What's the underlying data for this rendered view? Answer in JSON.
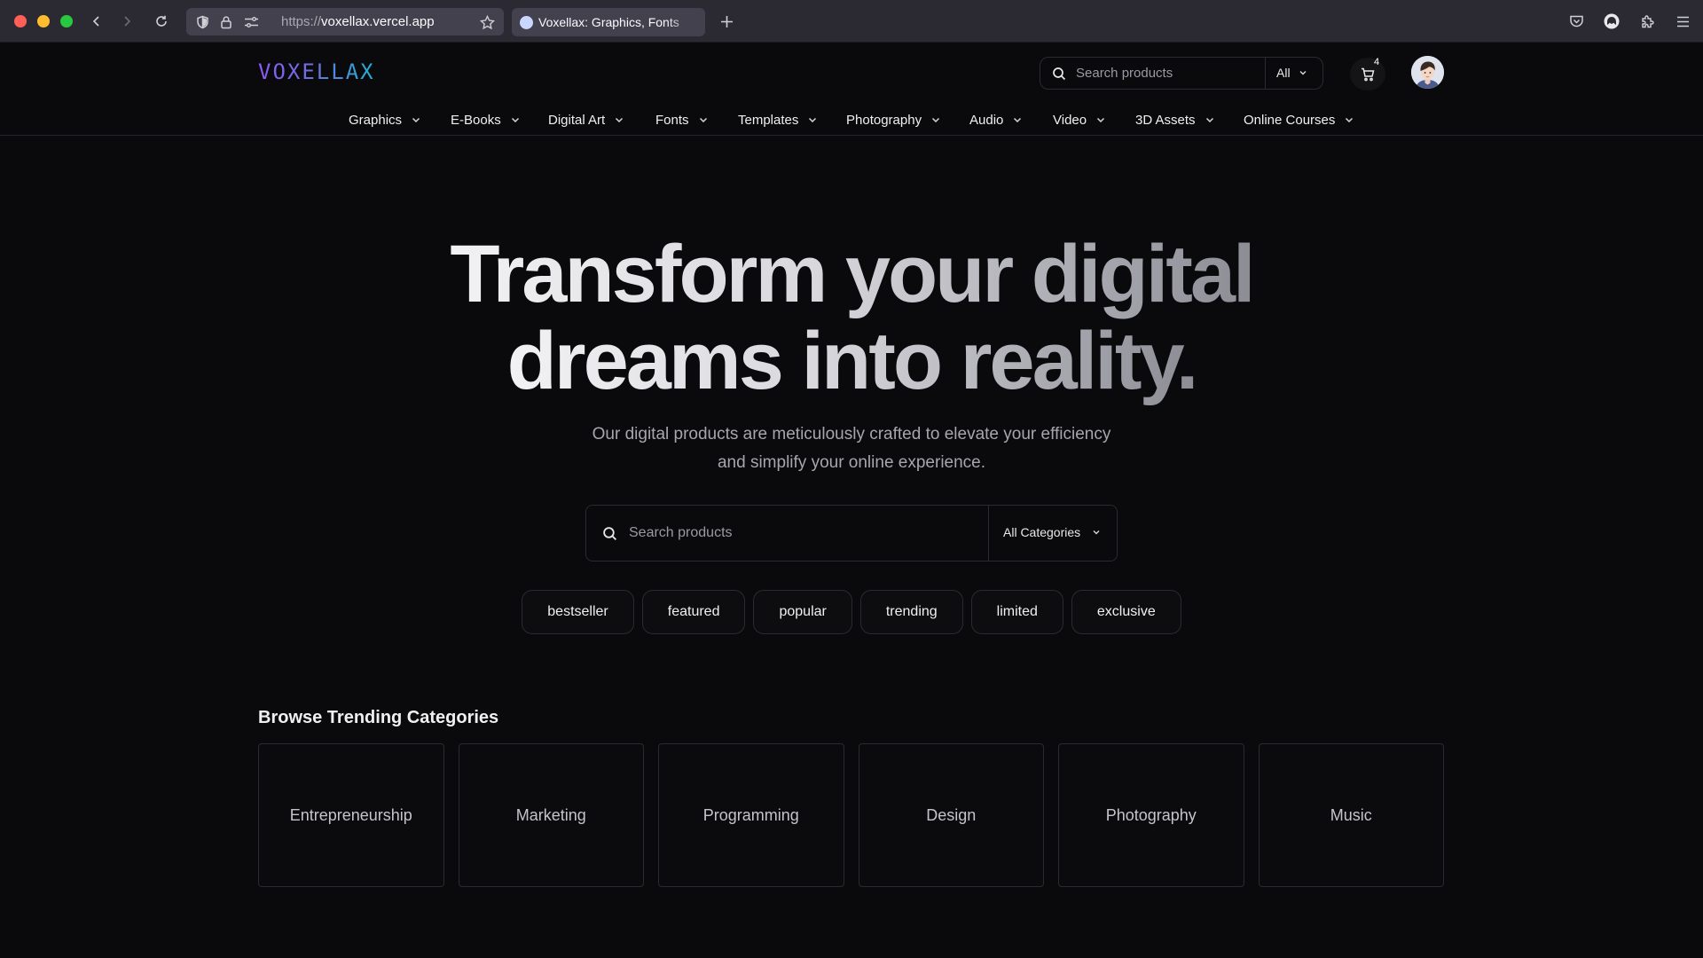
{
  "browser": {
    "url_scheme": "https://",
    "url_host": "voxellax.vercel.app",
    "tab_title": "Voxellax: Graphics, Fonts",
    "icons": [
      "back-icon",
      "forward-icon",
      "reload-icon",
      "shield-icon",
      "lock-icon",
      "permissions-icon",
      "bookmark-star-icon",
      "new-tab-icon",
      "pocket-icon",
      "account-icon",
      "extensions-icon",
      "menu-icon"
    ]
  },
  "header": {
    "logo": "VOXELLAX",
    "search_placeholder": "Search products",
    "search_scope": "All",
    "cart_count": "4"
  },
  "nav": {
    "items": [
      {
        "label": "Graphics"
      },
      {
        "label": "E-Books"
      },
      {
        "label": "Digital Art"
      },
      {
        "label": "Fonts"
      },
      {
        "label": "Templates"
      },
      {
        "label": "Photography"
      },
      {
        "label": "Audio"
      },
      {
        "label": "Video"
      },
      {
        "label": "3D Assets"
      },
      {
        "label": "Online Courses"
      }
    ]
  },
  "hero": {
    "title_line1": "Transform your digital",
    "title_line2": "dreams into reality.",
    "subtitle": "Our digital products are meticulously crafted to elevate your efficiency and simplify your online experience.",
    "search_placeholder": "Search products",
    "category_select": "All Categories",
    "tags": [
      "bestseller",
      "featured",
      "popular",
      "trending",
      "limited",
      "exclusive"
    ]
  },
  "categories": {
    "title": "Browse Trending Categories",
    "items": [
      "Entrepreneurship",
      "Marketing",
      "Programming",
      "Design",
      "Photography",
      "Music"
    ]
  },
  "colors": {
    "background": "#0a0a0c",
    "logo_gradient_start": "#8b5cf6",
    "logo_gradient_end": "#1fb3d1",
    "border": "#2a2a31"
  }
}
